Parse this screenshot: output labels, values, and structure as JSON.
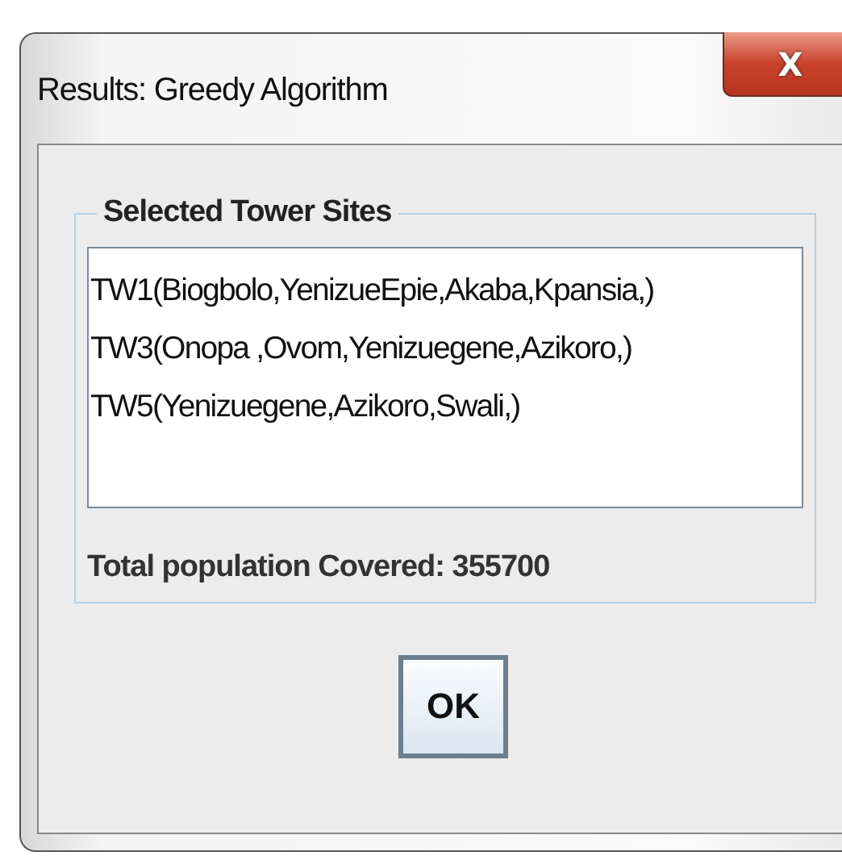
{
  "window": {
    "title": "Results: Greedy Algorithm",
    "close_label": "X"
  },
  "group": {
    "title": "Selected Tower Sites",
    "lines": [
      "TW1(Biogbolo,YenizueEpie,Akaba,Kpansia,)",
      "TW3(Onopa ,Ovom,Yenizuegene,Azikoro,)",
      "TW5(Yenizuegene,Azikoro,Swali,)"
    ],
    "total": "Total population Covered: 355700"
  },
  "buttons": [
    "OK"
  ]
}
